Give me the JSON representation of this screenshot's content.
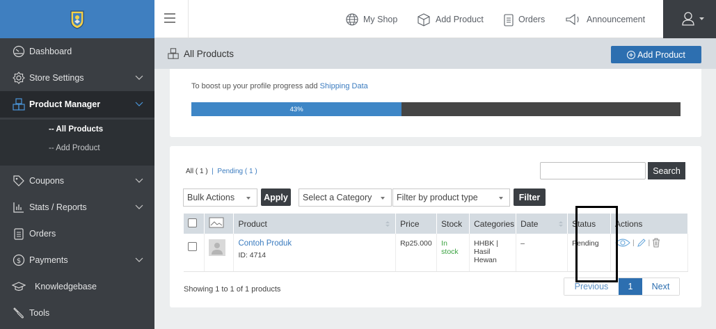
{
  "topbar": {
    "my_shop": "My Shop",
    "add_product": "Add Product",
    "orders": "Orders",
    "announcement": "Announcement"
  },
  "sidebar": {
    "items": [
      {
        "label": "Dashboard",
        "icon": "dashboard-icon"
      },
      {
        "label": "Store Settings",
        "icon": "gear-icon"
      },
      {
        "label": "Product Manager",
        "icon": "boxes-icon"
      },
      {
        "label": "Coupons",
        "icon": "tag-icon"
      },
      {
        "label": "Stats / Reports",
        "icon": "bar-chart-icon"
      },
      {
        "label": "Orders",
        "icon": "clipboard-icon"
      },
      {
        "label": "Payments",
        "icon": "dollar-icon"
      },
      {
        "label": "Knowledgebase",
        "icon": "graduation-cap-icon"
      },
      {
        "label": "Tools",
        "icon": "wrench-icon"
      }
    ],
    "submenu": [
      "-- All Products",
      "-- Add Product"
    ]
  },
  "page": {
    "title": "All Products",
    "add_button": "Add Product"
  },
  "progress": {
    "prefix": "To boost up your profile progress add ",
    "link": "Shipping Data",
    "percent": 43,
    "label": "43%"
  },
  "filters": {
    "all": "All",
    "all_count": "( 1 )",
    "separator": "|",
    "pending": "Pending",
    "pending_count": "( 1 )",
    "search_button": "Search",
    "search_value": "",
    "bulk_actions": "Bulk Actions",
    "apply": "Apply",
    "category": "Select a Category",
    "product_type": "Filter by product type",
    "filter": "Filter"
  },
  "table": {
    "headers": [
      "Product",
      "Price",
      "Stock",
      "Categories",
      "Date",
      "Status",
      "Actions"
    ],
    "rows": [
      {
        "name": "Contoh Produk",
        "id": "ID: 4714",
        "price": "Rp25.000",
        "stock_line1": "In",
        "stock_line2": "stock",
        "cat_line1": "HHBK |",
        "cat_line2": "Hasil",
        "cat_line3": "Hewan",
        "date": "–",
        "status": "Pending",
        "sep": "|"
      }
    ]
  },
  "footer": {
    "showing": "Showing 1 to 1 of 1 products",
    "previous": "Previous",
    "page": "1",
    "next": "Next"
  },
  "colors": {
    "sidebar": "#3a3e43",
    "sidebar_active": "#26292d",
    "accent": "#2d6fb0",
    "progress": "#3e86c6",
    "in_stock": "#3aa241"
  }
}
